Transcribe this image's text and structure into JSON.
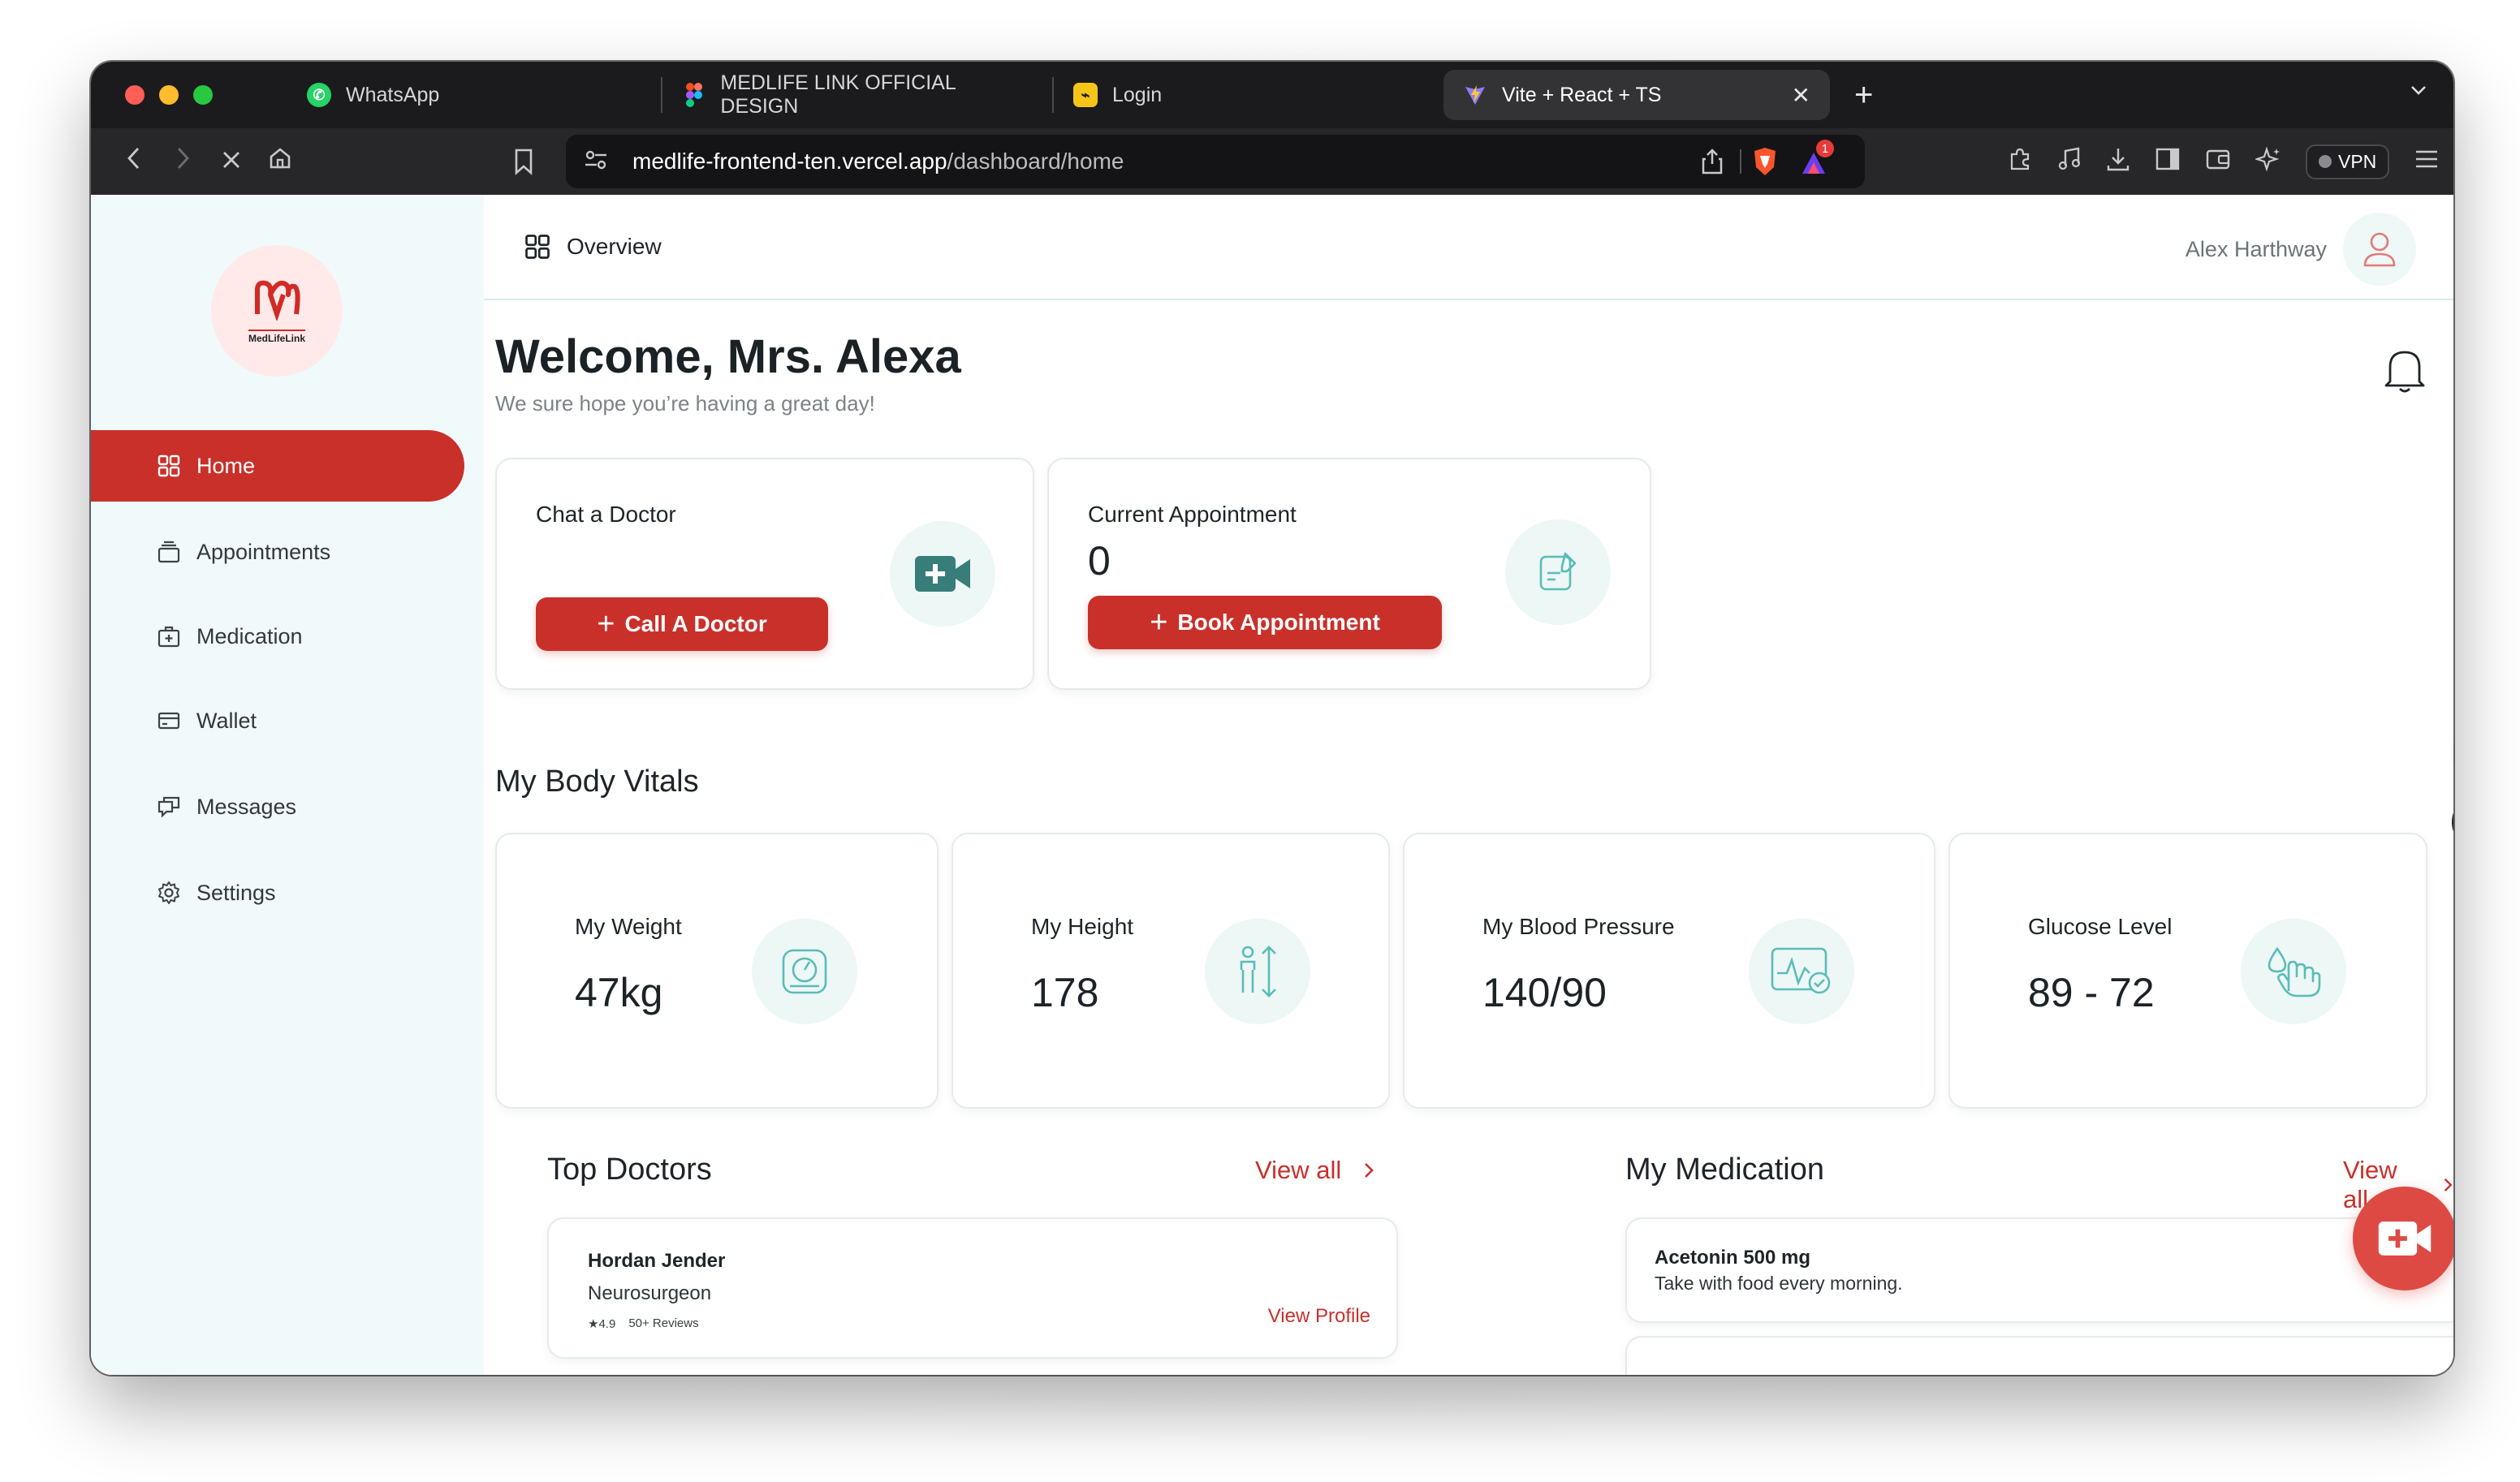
{
  "browser": {
    "tabs": [
      {
        "label": "WhatsApp",
        "icon": "whatsapp-icon",
        "active": false
      },
      {
        "label": "MEDLIFE LINK OFFICIAL DESIGN",
        "icon": "figma-icon",
        "active": false
      },
      {
        "label": "Login",
        "icon": "login-icon",
        "active": false
      },
      {
        "label": "Vite + React + TS",
        "icon": "vite-icon",
        "active": true
      }
    ],
    "url_host": "medlife-frontend-ten.vercel.app",
    "url_path": "/dashboard/home",
    "vpn_label": "VPN",
    "brave_badge": "1",
    "colors": {
      "tabbar": "#1b1b1d",
      "toolbar": "#27272a"
    }
  },
  "sidebar": {
    "logo_text": "MedLifeLink",
    "items": [
      {
        "label": "Home",
        "icon": "grid-icon",
        "active": true
      },
      {
        "label": "Appointments",
        "icon": "calendar-stack-icon",
        "active": false
      },
      {
        "label": "Medication",
        "icon": "medkit-icon",
        "active": false
      },
      {
        "label": "Wallet",
        "icon": "wallet-icon",
        "active": false
      },
      {
        "label": "Messages",
        "icon": "chat-icon",
        "active": false
      },
      {
        "label": "Settings",
        "icon": "gear-icon",
        "active": false
      }
    ]
  },
  "header": {
    "title": "Overview",
    "user_name": "Alex Harthway"
  },
  "main": {
    "welcome": "Welcome, Mrs. Alexa",
    "subtitle": "We sure hope you’re having a great day!",
    "chat_card": {
      "title": "Chat a Doctor",
      "button": "Call A Doctor",
      "icon": "video-plus-icon"
    },
    "appointment_card": {
      "title": "Current Appointment",
      "value": "0",
      "button": "Book Appointment",
      "icon": "clipboard-edit-icon"
    },
    "vitals_title": "My Body Vitals",
    "vitals": [
      {
        "label": "My Weight",
        "value": "47kg",
        "icon": "scale-icon"
      },
      {
        "label": "My Height",
        "value": "178",
        "icon": "height-icon"
      },
      {
        "label": "My Blood Pressure",
        "value": "140/90",
        "icon": "blood-pressure-icon"
      },
      {
        "label": "Glucose Level",
        "value": "89 - 72",
        "icon": "glucose-icon"
      }
    ],
    "top_doctors": {
      "title": "Top Doctors",
      "view_all": "View all",
      "items": [
        {
          "name": "Hordan Jender",
          "specialty": "Neurosurgeon",
          "rating": "4.9",
          "reviews": "50+ Reviews",
          "action": "View Profile"
        }
      ]
    },
    "medication": {
      "title": "My Medication",
      "view_all": "View all",
      "items": [
        {
          "name": "Acetonin 500 mg",
          "note": "Take with food every morning."
        }
      ]
    },
    "colors": {
      "accent": "#c9302a",
      "teal": "#3a9b95",
      "sidebar_bg": "#f1fafa"
    }
  }
}
